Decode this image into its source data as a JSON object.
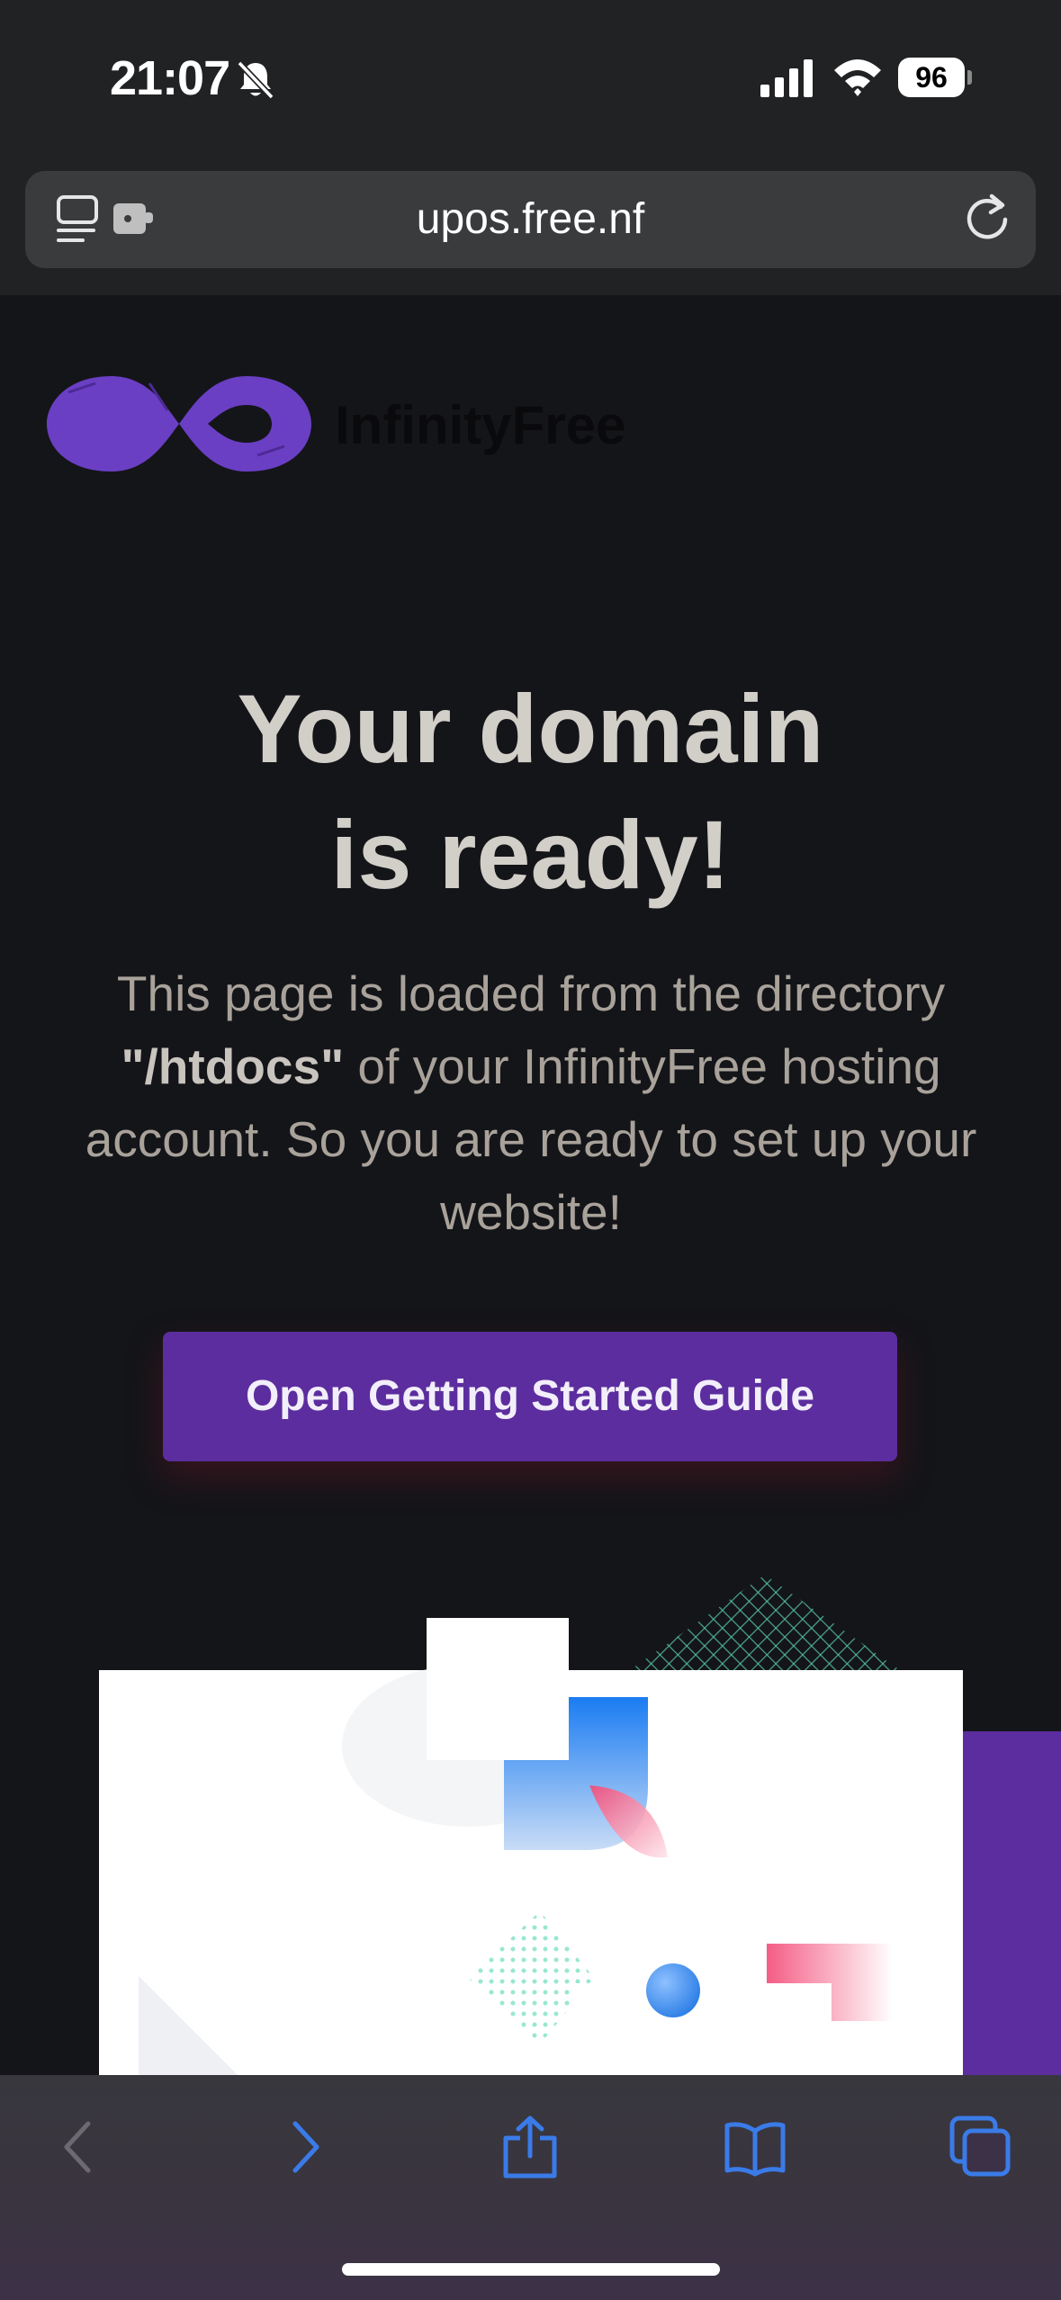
{
  "status_bar": {
    "time": "21:07",
    "battery": "96",
    "icons": [
      "bell-slash-icon",
      "cellular-signal-icon",
      "wifi-icon",
      "battery-icon"
    ]
  },
  "browser": {
    "url": "upos.free.nf",
    "icons": [
      "reader-icon",
      "extension-icon",
      "reload-icon"
    ]
  },
  "page": {
    "logo_text": "InfinityFree",
    "headline_line1": "Your domain",
    "headline_line2": "is ready!",
    "sub_part1": "This page is loaded from the directory ",
    "sub_code": "\"/htdocs\"",
    "sub_part2": " of your InfinityFree hosting account. So you are ready to set up your website!",
    "cta_label": "Open Getting Started Guide"
  },
  "toolbar": {
    "icons": [
      "back-icon",
      "forward-icon",
      "share-icon",
      "bookmarks-icon",
      "tabs-icon"
    ]
  },
  "colors": {
    "accent": "#5c2d9e",
    "link_blue": "#3a7be8",
    "page_bg": "#141519"
  }
}
